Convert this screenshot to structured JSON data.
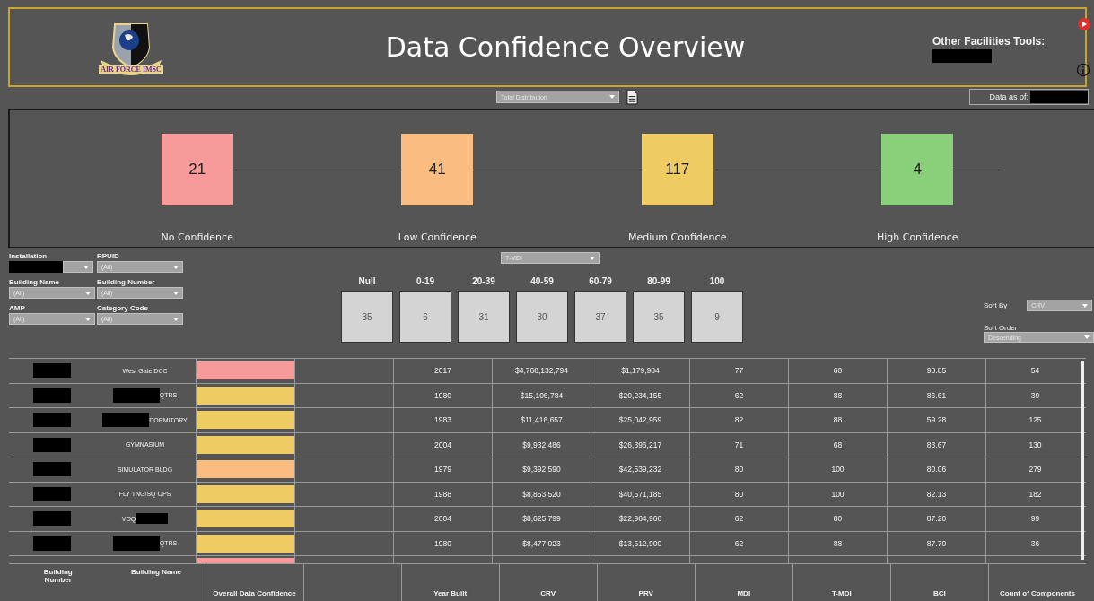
{
  "header": {
    "title": "Data Confidence Overview",
    "logo_text": "AIR FORCE IMSC",
    "tools_label": "Other Facilities Tools:"
  },
  "toolbar": {
    "distribution": "Total Distribution",
    "data_as_of": "Data as of:"
  },
  "confidence_levels": [
    {
      "count": "21",
      "label": "No Confidence",
      "color": "#f79a9a"
    },
    {
      "count": "41",
      "label": "Low Confidence",
      "color": "#fbbd7f"
    },
    {
      "count": "117",
      "label": "Medium Confidence",
      "color": "#eecb63"
    },
    {
      "count": "4",
      "label": "High Confidence",
      "color": "#8ad07a"
    }
  ],
  "filters": [
    {
      "label": "Installation",
      "redacted": true
    },
    {
      "label": "RPUID",
      "value": "(All)",
      "redacted": false
    },
    {
      "label": "Building Name",
      "value": "(All)",
      "redacted": false
    },
    {
      "label": "Building Number",
      "value": "(All)",
      "redacted": false
    },
    {
      "label": "AMP",
      "value": "(All)",
      "redacted": false
    },
    {
      "label": "Category Code",
      "value": "(All)",
      "redacted": false
    }
  ],
  "histogram": {
    "metric": "T-MDI",
    "bins": [
      {
        "label": "Null",
        "count": "35"
      },
      {
        "label": "0-19",
        "count": "6"
      },
      {
        "label": "20-39",
        "count": "31"
      },
      {
        "label": "40-59",
        "count": "30"
      },
      {
        "label": "60-79",
        "count": "37"
      },
      {
        "label": "80-99",
        "count": "35"
      },
      {
        "label": "100",
        "count": "9"
      }
    ]
  },
  "sort": {
    "by_label": "Sort By",
    "by_value": "CRV",
    "order_label": "Sort Order",
    "order_value": "Descending"
  },
  "table": {
    "columns": [
      "Building Number",
      "Building Name",
      "Overall Data Confidence",
      "",
      "Year Built",
      "CRV",
      "PRV",
      "MDI",
      "T-MDI",
      "BCI",
      "Count of Components"
    ],
    "rows": [
      {
        "name": "West Gate DCC",
        "kind": "plain",
        "color": "#f79a9a",
        "year": "2017",
        "crv": "$4,768,132,794",
        "prv": "$1,179,984",
        "mdi": "77",
        "tmdi": "60",
        "bci": "98.85",
        "components": "54"
      },
      {
        "name": "QTRS",
        "kind": "masked_prefix",
        "color": "#eecb63",
        "year": "1980",
        "crv": "$15,106,784",
        "prv": "$20,234,155",
        "mdi": "62",
        "tmdi": "88",
        "bci": "86.61",
        "components": "39"
      },
      {
        "name": "DORMITORY",
        "kind": "masked_prefix",
        "color": "#eecb63",
        "year": "1983",
        "crv": "$11,416,657",
        "prv": "$25,042,959",
        "mdi": "82",
        "tmdi": "88",
        "bci": "59.28",
        "components": "125"
      },
      {
        "name": "GYMNASIUM",
        "kind": "plain",
        "color": "#eecb63",
        "year": "2004",
        "crv": "$9,932,486",
        "prv": "$26,396,217",
        "mdi": "71",
        "tmdi": "68",
        "bci": "83.67",
        "components": "130"
      },
      {
        "name": "SIMULATOR BLDG",
        "kind": "plain",
        "color": "#fbbd7f",
        "year": "1979",
        "crv": "$9,392,590",
        "prv": "$42,539,232",
        "mdi": "80",
        "tmdi": "100",
        "bci": "80.06",
        "components": "279"
      },
      {
        "name": "FLY TNG/SQ OPS",
        "kind": "plain",
        "color": "#eecb63",
        "year": "1988",
        "crv": "$8,853,520",
        "prv": "$40,571,185",
        "mdi": "80",
        "tmdi": "100",
        "bci": "82.13",
        "components": "182"
      },
      {
        "name": "VOQ",
        "kind": "masked_suffix",
        "color": "#eecb63",
        "year": "2004",
        "crv": "$8,625,799",
        "prv": "$22,964,966",
        "mdi": "62",
        "tmdi": "80",
        "bci": "87.20",
        "components": "99"
      },
      {
        "name": "QTRS",
        "kind": "masked_prefix",
        "color": "#eecb63",
        "year": "1980",
        "crv": "$8,477,023",
        "prv": "$13,512,900",
        "mdi": "62",
        "tmdi": "88",
        "bci": "87.70",
        "components": "36"
      }
    ],
    "partial_row": {
      "color": "#f79a9a"
    }
  }
}
